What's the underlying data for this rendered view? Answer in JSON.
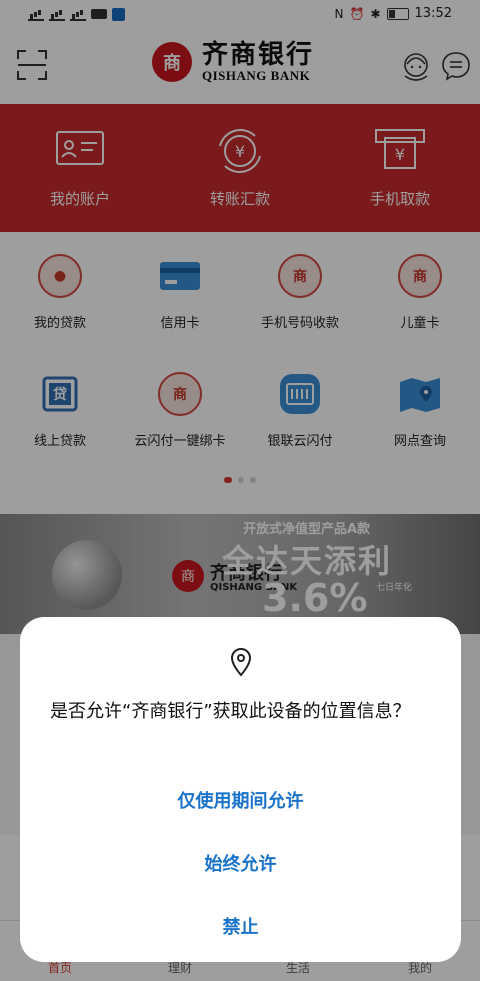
{
  "status_bar": {
    "time": "13:52",
    "nfc": "N"
  },
  "header": {
    "bank_name_cn": "齐商银行",
    "bank_name_en": "QISHANG BANK",
    "seal_char": "商"
  },
  "quick_actions": [
    {
      "label": "我的账户",
      "icon": "account-card-icon"
    },
    {
      "label": "转账汇款",
      "icon": "transfer-yuan-icon"
    },
    {
      "label": "手机取款",
      "icon": "atm-withdraw-icon"
    }
  ],
  "services": [
    {
      "label": "我的贷款",
      "icon": "loan-coin-icon"
    },
    {
      "label": "信用卡",
      "icon": "credit-card-icon"
    },
    {
      "label": "手机号码收款",
      "icon": "phone-collect-icon"
    },
    {
      "label": "儿童卡",
      "icon": "child-card-icon"
    },
    {
      "label": "线上贷款",
      "icon": "online-loan-icon",
      "glyph": "贷"
    },
    {
      "label": "云闪付一键绑卡",
      "icon": "quickpass-bind-icon"
    },
    {
      "label": "银联云闪付",
      "icon": "unionpay-quickpass-icon"
    },
    {
      "label": "网点查询",
      "icon": "map-branch-icon"
    }
  ],
  "carousel": {
    "pages": 3,
    "active": 0
  },
  "banner": {
    "subtitle": "开放式净值型产品A款",
    "title": "全达天添利",
    "rate": "3.6%",
    "rate_note": "七日年化",
    "bank_cn": "齐商银行",
    "bank_en": "QISHANG BANK"
  },
  "bottom_nav": [
    {
      "label": "首页",
      "active": true
    },
    {
      "label": "理财",
      "active": false
    },
    {
      "label": "生活",
      "active": false
    },
    {
      "label": "我的",
      "active": false
    }
  ],
  "dialog": {
    "message": "是否允许“齐商银行”获取此设备的位置信息？",
    "allow_while_using": "仅使用期间允许",
    "always_allow": "始终允许",
    "deny": "禁止"
  },
  "colors": {
    "brand_red": "#c52a2e",
    "dialog_button": "#1a73c9"
  }
}
